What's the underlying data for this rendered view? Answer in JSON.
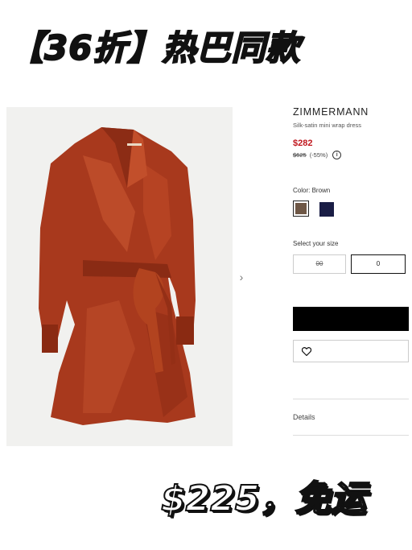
{
  "banners": {
    "top": "【36折】热巴同款",
    "bottom": "$225，免运"
  },
  "product": {
    "brand": "ZIMMERMANN",
    "name": "Silk-satin mini wrap dress",
    "sale_price": "$282",
    "original_price": "$625",
    "discount": "(-55%)",
    "info_icon": "i",
    "image_icon": "dress-photo",
    "carousel_next_icon": "›"
  },
  "color": {
    "label": "Color: Brown",
    "options": [
      {
        "name": "brown",
        "hex": "#6e5746",
        "selected": true
      },
      {
        "name": "navy",
        "hex": "#1a1d45",
        "selected": false
      }
    ]
  },
  "size": {
    "label": "Select your size",
    "options": [
      {
        "label": "00",
        "available": false
      },
      {
        "label": "0",
        "available": true
      }
    ]
  },
  "actions": {
    "add_to_bag_label": "",
    "wishlist_icon": "heart-icon"
  },
  "details": {
    "label": "Details"
  }
}
